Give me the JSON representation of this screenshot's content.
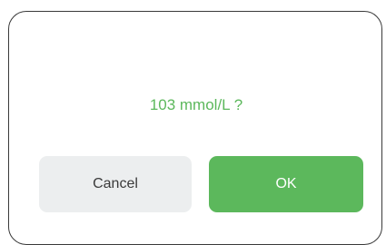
{
  "dialog": {
    "message": "103 mmol/L ?",
    "cancel_label": "Cancel",
    "ok_label": "OK"
  },
  "colors": {
    "accent": "#5cb85c",
    "cancel_bg": "#eceeef",
    "text_dark": "#3a3a3a",
    "border": "#3a3a3a"
  }
}
